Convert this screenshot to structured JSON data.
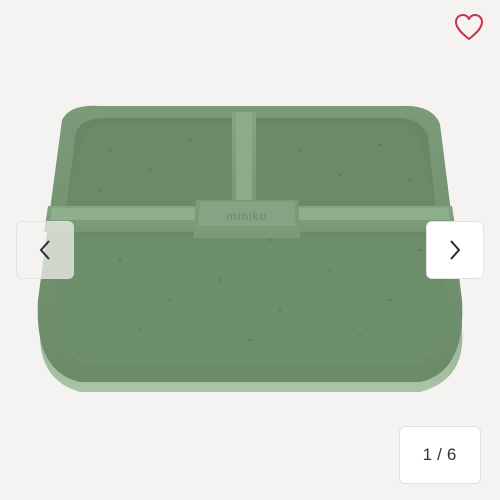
{
  "gallery": {
    "image_alt": "miniko",
    "plate_logo_text": "miniko",
    "favorite_icon": "heart-outline-icon",
    "favorite_color": "#c8334a",
    "prev_icon": "chevron-left-icon",
    "next_icon": "chevron-right-icon",
    "pager": {
      "current": "1",
      "separator": "/",
      "total": "6"
    }
  },
  "colors": {
    "background": "#f4f3f1",
    "plate_main": "#6e8f6c",
    "plate_light": "#86a483",
    "plate_dark": "#587a57",
    "plate_base": "#9cb99a"
  }
}
